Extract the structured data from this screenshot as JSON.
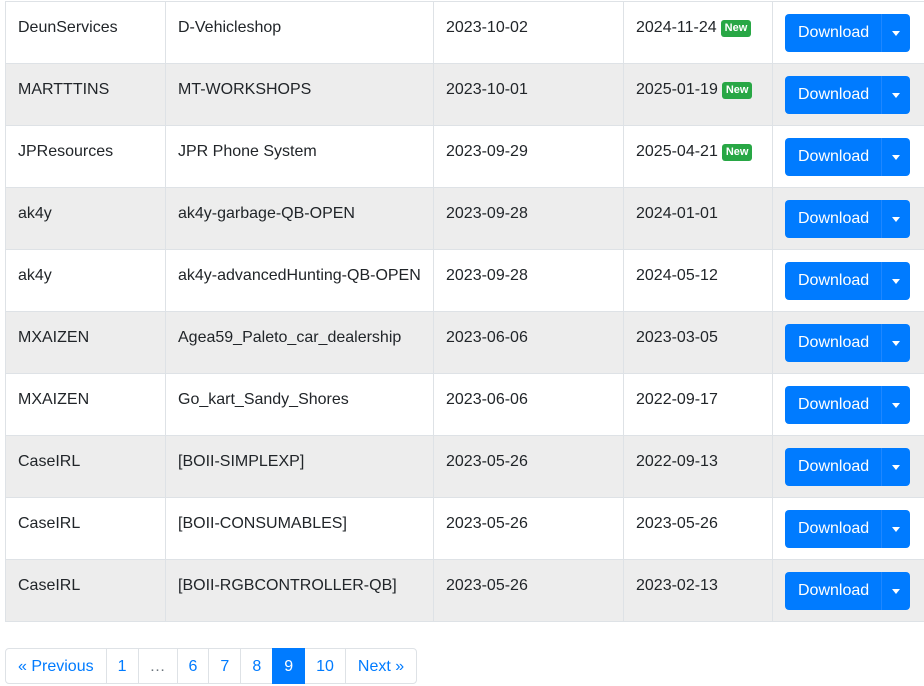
{
  "rows": [
    {
      "author": "DeunServices",
      "name": "D-Vehicleshop",
      "created": "2023-10-02",
      "updated": "2024-11-24",
      "badge": "New"
    },
    {
      "author": "MARTTTINS",
      "name": "MT-WORKSHOPS",
      "created": "2023-10-01",
      "updated": "2025-01-19",
      "badge": "New"
    },
    {
      "author": "JPResources",
      "name": "JPR Phone System",
      "created": "2023-09-29",
      "updated": "2025-04-21",
      "badge": "New"
    },
    {
      "author": "ak4y",
      "name": "ak4y-garbage-QB-OPEN",
      "created": "2023-09-28",
      "updated": "2024-01-01",
      "badge": ""
    },
    {
      "author": "ak4y",
      "name": "ak4y-advancedHunting-QB-OPEN",
      "created": "2023-09-28",
      "updated": "2024-05-12",
      "badge": ""
    },
    {
      "author": "MXAIZEN",
      "name": "Agea59_Paleto_car_dealership",
      "created": "2023-06-06",
      "updated": "2023-03-05",
      "badge": ""
    },
    {
      "author": "MXAIZEN",
      "name": "Go_kart_Sandy_Shores",
      "created": "2023-06-06",
      "updated": "2022-09-17",
      "badge": ""
    },
    {
      "author": "CaseIRL",
      "name": "[BOII-SIMPLEXP]",
      "created": "2023-05-26",
      "updated": "2022-09-13",
      "badge": ""
    },
    {
      "author": "CaseIRL",
      "name": "[BOII-CONSUMABLES]",
      "created": "2023-05-26",
      "updated": "2023-05-26",
      "badge": ""
    },
    {
      "author": "CaseIRL",
      "name": "[BOII-RGBCONTROLLER-QB]",
      "created": "2023-05-26",
      "updated": "2023-02-13",
      "badge": ""
    }
  ],
  "download_label": "Download",
  "caret_icon": "caret-down-icon",
  "pagination": {
    "prev": "« Previous",
    "pages": [
      "1",
      "…",
      "6",
      "7",
      "8",
      "9",
      "10"
    ],
    "active": "9",
    "next": "Next »"
  },
  "colors": {
    "primary": "#007bff",
    "badge_new": "#28a745",
    "row_alt": "#ededed"
  }
}
